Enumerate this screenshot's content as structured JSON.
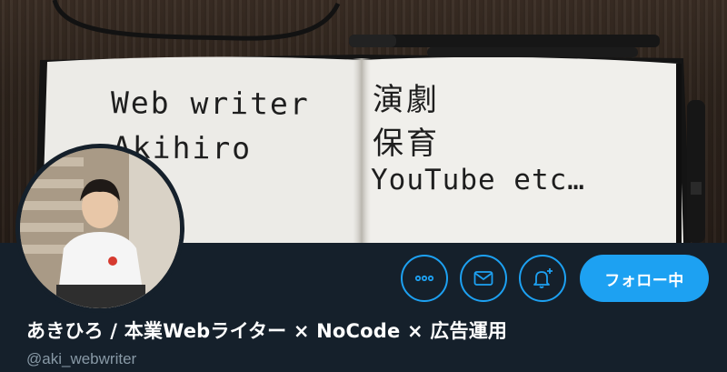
{
  "banner": {
    "left_page_lines": [
      "Web writer",
      "Akihiro"
    ],
    "right_page_lines": [
      "演劇",
      "保育",
      "YouTube etc…"
    ]
  },
  "profile": {
    "display_name": "あきひろ / 本業Webライター × NoCode × 広告運用",
    "handle": "@aki_webwriter"
  },
  "actions": {
    "more_icon": "more-dots-icon",
    "message_icon": "envelope-icon",
    "notify_icon": "bell-plus-icon",
    "follow_label": "フォロー中"
  },
  "colors": {
    "background": "#15202b",
    "accent": "#1da1f2",
    "secondary_text": "#8899a6"
  }
}
